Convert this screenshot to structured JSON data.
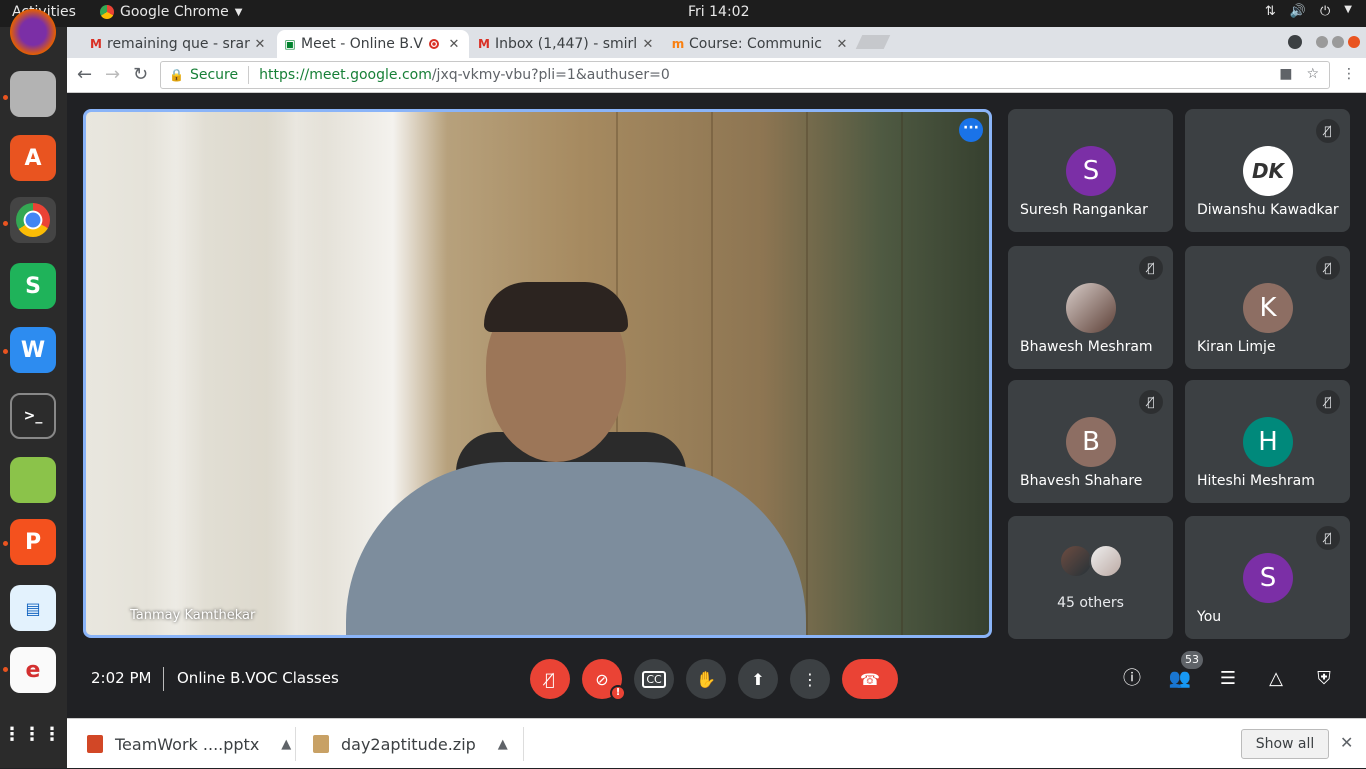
{
  "topbar": {
    "activities": "Activities",
    "app_name": "Google Chrome",
    "clock": "Fri 14:02"
  },
  "tabs": [
    {
      "label": "remaining que - srar",
      "favicon": "gmail-icon",
      "active": false
    },
    {
      "label": "Meet - Online B.V",
      "favicon": "meet-icon",
      "active": true
    },
    {
      "label": "Inbox (1,447) - smirl",
      "favicon": "gmail-icon",
      "active": false
    },
    {
      "label": "Course: Communic",
      "favicon": "moodle-icon",
      "active": false
    }
  ],
  "address_bar": {
    "secure_label": "Secure",
    "url_host": "https://meet.google.com",
    "url_path": "/jxq-vkmy-vbu?pli=1&authuser=0"
  },
  "meet": {
    "presenter_name": "Tanmay Kamthekar",
    "time": "2:02 PM",
    "meeting_title": "Online B.VOC Classes",
    "participant_count": "53",
    "participants": [
      {
        "name": "Suresh Rangankar",
        "initial": "S",
        "color": "#7b2fa6",
        "muted": false
      },
      {
        "name": "Diwanshu Kawadkar",
        "initial": "",
        "color": "#ffffff",
        "muted": true,
        "logo_text": "DK"
      },
      {
        "name": "Bhawesh Meshram",
        "initial": "",
        "color": "#8a8a8a",
        "muted": true
      },
      {
        "name": "Kiran Limje",
        "initial": "K",
        "color": "#8d6e63",
        "muted": true
      },
      {
        "name": "Bhavesh Shahare",
        "initial": "B",
        "color": "#8d6e63",
        "muted": true
      },
      {
        "name": "Hiteshi Meshram",
        "initial": "H",
        "color": "#00897b",
        "muted": true
      },
      {
        "name": "45 others",
        "initial": "",
        "color": "",
        "muted": false
      },
      {
        "name": "You",
        "initial": "S",
        "color": "#7b2fa6",
        "muted": true
      }
    ]
  },
  "downloads": {
    "items": [
      {
        "name": "TeamWork ....pptx",
        "icon": "pptx-file-icon"
      },
      {
        "name": "day2aptitude.zip",
        "icon": "zip-file-icon"
      }
    ],
    "show_all": "Show all"
  },
  "colors": {
    "meet_bg": "#202124",
    "tile_bg": "#3c4043",
    "danger": "#ea4335",
    "active_border": "#8ab4f8",
    "secure_green": "#188038"
  }
}
